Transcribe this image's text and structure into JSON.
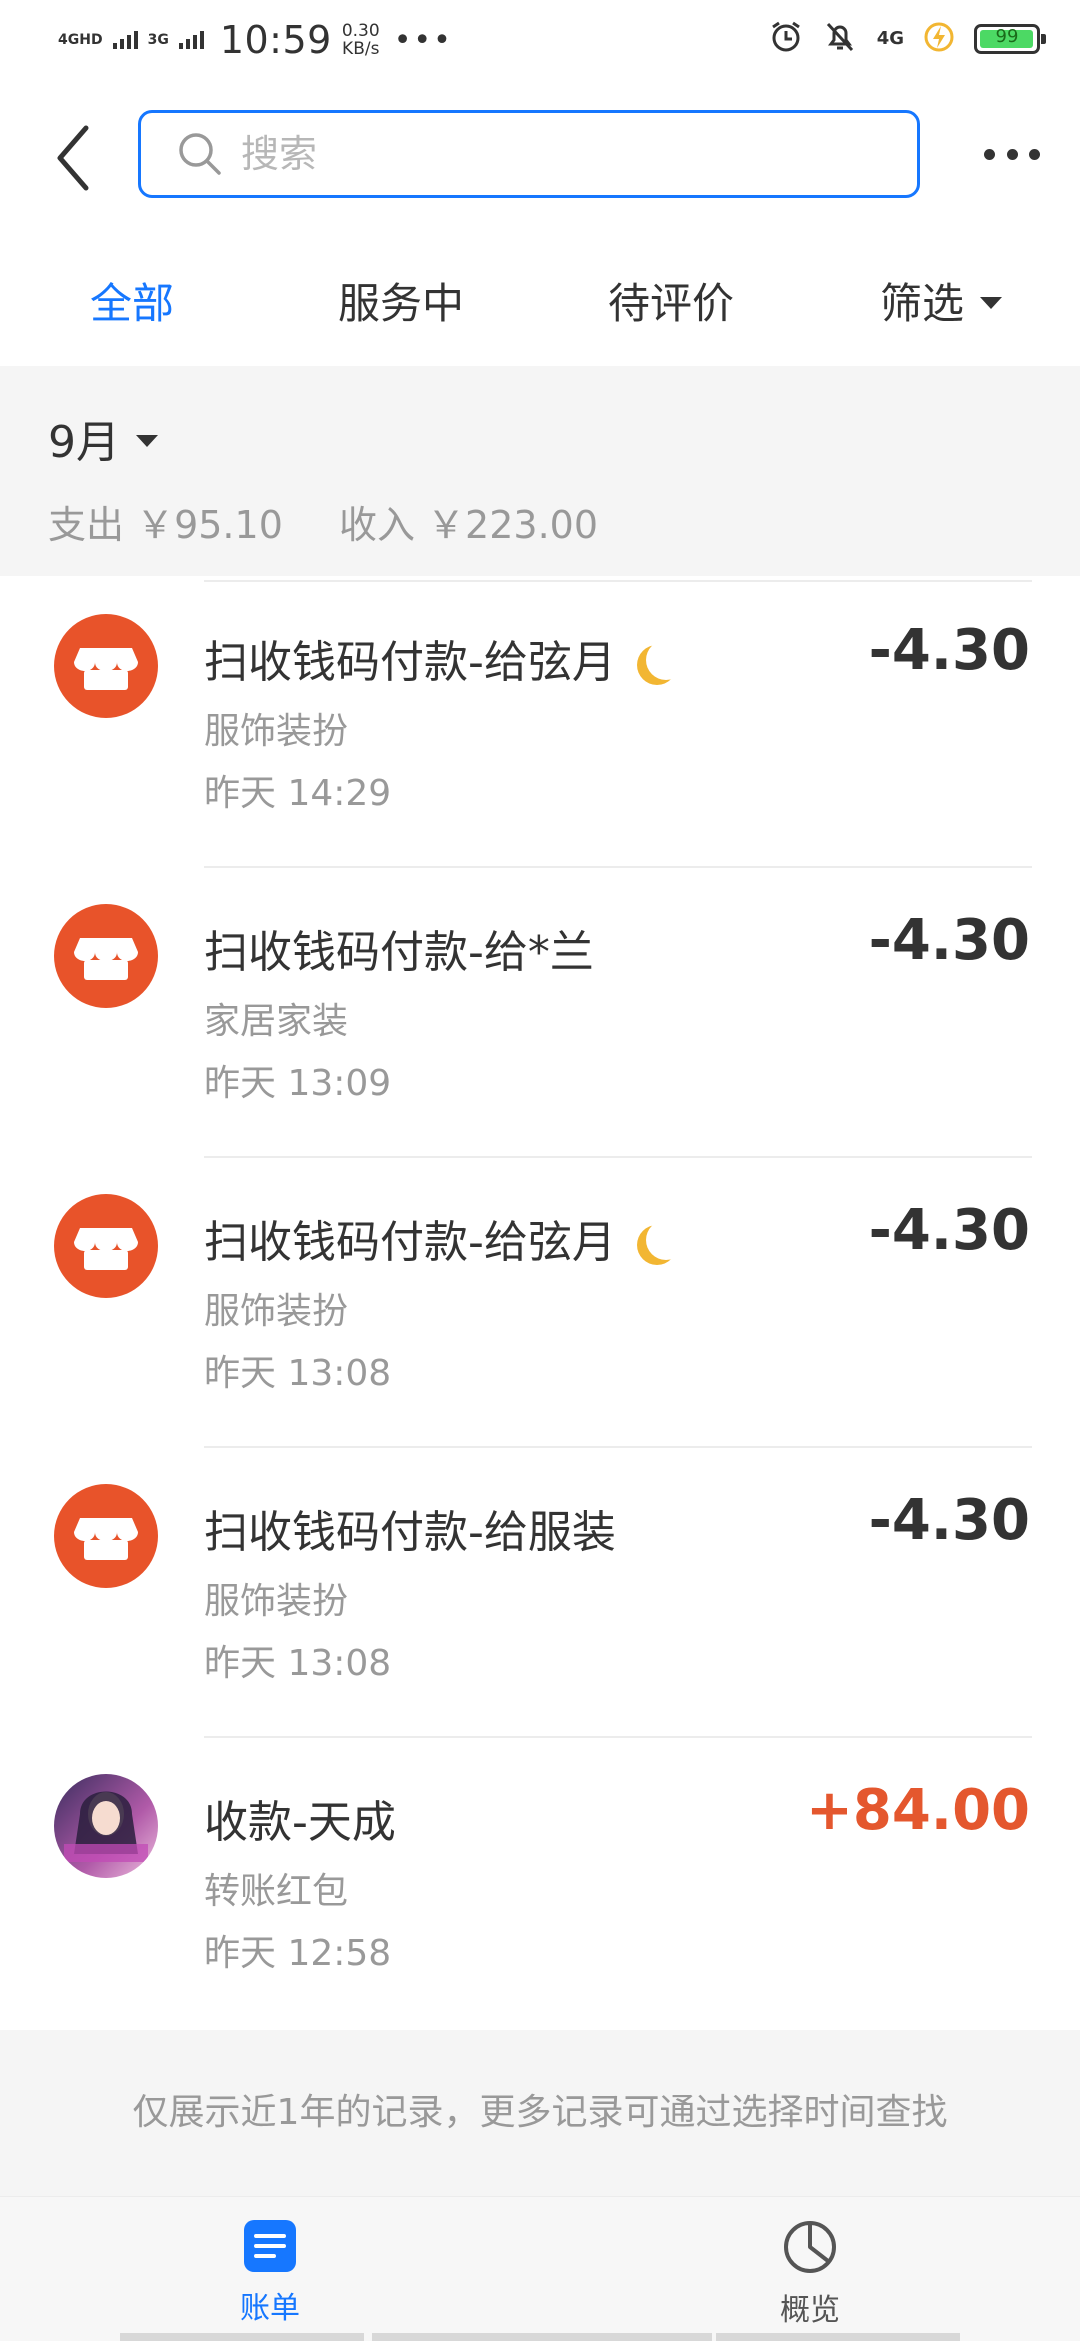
{
  "status_bar": {
    "network_1": "4GHD",
    "network_2": "3G",
    "time": "10:59",
    "speed_value": "0.30",
    "speed_unit": "KB/s",
    "more_dots": "•••",
    "network_right": "4G",
    "battery_level": "99",
    "battery_color": "#4cd964"
  },
  "header": {
    "search_placeholder": "搜索"
  },
  "tabs": [
    {
      "label": "全部",
      "active": true
    },
    {
      "label": "服务中",
      "active": false
    },
    {
      "label": "待评价",
      "active": false
    },
    {
      "label": "筛选",
      "active": false
    }
  ],
  "summary": {
    "month": "9月",
    "expense": "支出 ￥95.10",
    "income": "收入 ￥223.00"
  },
  "transactions": [
    {
      "title": "扫收钱码付款-给弦月",
      "emoji": "moon",
      "category": "服饰装扮",
      "time": "昨天  14:29",
      "amount": "-4.30",
      "icon": "store-icon"
    },
    {
      "title": "扫收钱码付款-给*兰",
      "emoji": "",
      "category": "家居家装",
      "time": "昨天  13:09",
      "amount": "-4.30",
      "icon": "store-icon"
    },
    {
      "title": "扫收钱码付款-给弦月",
      "emoji": "moon",
      "category": "服饰装扮",
      "time": "昨天  13:08",
      "amount": "-4.30",
      "icon": "store-icon"
    },
    {
      "title": "扫收钱码付款-给服装",
      "emoji": "",
      "category": "服饰装扮",
      "time": "昨天  13:08",
      "amount": "-4.30",
      "icon": "store-icon"
    },
    {
      "title": "收款-天成",
      "emoji": "",
      "category": "转账红包",
      "time": "昨天  12:58",
      "amount": "+84.00",
      "icon": "avatar"
    }
  ],
  "footer_note": "仅展示近1年的记录，更多记录可通过选择时间查找",
  "bottom_nav": [
    {
      "label": "账单",
      "icon": "bill-icon",
      "active": true
    },
    {
      "label": "概览",
      "icon": "pie-chart-icon",
      "active": false
    }
  ],
  "colors": {
    "accent": "#1677ff",
    "store": "#e8532a",
    "income": "#e4572e",
    "muted": "#999999"
  }
}
